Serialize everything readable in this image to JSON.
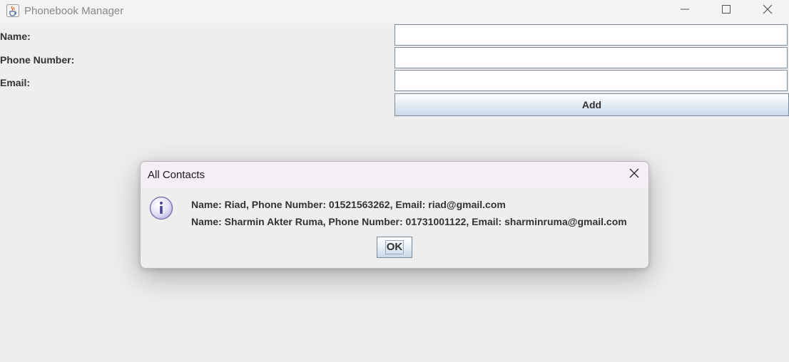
{
  "window": {
    "title": "Phonebook Manager",
    "icon": "java-coffee-icon",
    "controls": [
      "minimize-icon",
      "maximize-icon",
      "close-icon"
    ]
  },
  "form": {
    "name_label": "Name:",
    "phone_label": "Phone Number:",
    "email_label": "Email:",
    "name_value": "",
    "phone_value": "",
    "email_value": "",
    "add_label": "Add"
  },
  "dialog": {
    "title": "All Contacts",
    "icon": "info-icon",
    "lines": [
      "Name: Riad, Phone Number: 01521563262, Email: riad@gmail.com",
      "Name: Sharmin Akter Ruma, Phone Number: 01731001122, Email: sharminruma@gmail.com"
    ],
    "ok_label": "OK"
  },
  "colors": {
    "window_bg": "#eeeeee",
    "titlebar_bg": "#f3f3f3",
    "dialog_titlebar_bg": "#f5eef5",
    "button_gradient_top": "#ffffff",
    "button_gradient_bottom": "#c9d8e8",
    "text": "#333333"
  }
}
